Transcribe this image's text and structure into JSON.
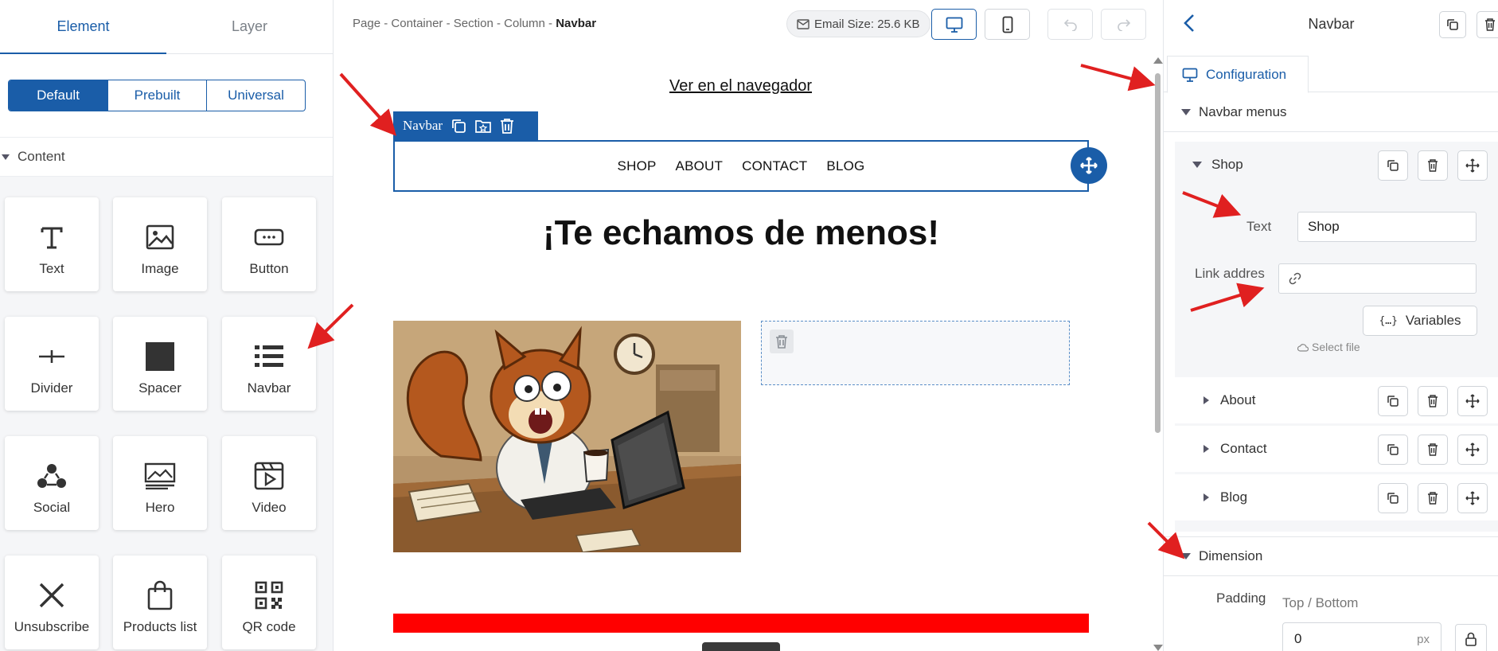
{
  "left_panel": {
    "tabs": [
      "Element",
      "Layer"
    ],
    "segments": [
      "Default",
      "Prebuilt",
      "Universal"
    ],
    "section_title": "Content",
    "tiles": [
      {
        "label": "Text",
        "icon": "text-icon"
      },
      {
        "label": "Image",
        "icon": "image-icon"
      },
      {
        "label": "Button",
        "icon": "button-icon"
      },
      {
        "label": "Divider",
        "icon": "divider-icon"
      },
      {
        "label": "Spacer",
        "icon": "spacer-icon"
      },
      {
        "label": "Navbar",
        "icon": "navbar-icon"
      },
      {
        "label": "Social",
        "icon": "social-icon"
      },
      {
        "label": "Hero",
        "icon": "hero-icon"
      },
      {
        "label": "Video",
        "icon": "video-icon"
      },
      {
        "label": "Unsubscribe",
        "icon": "unsubscribe-icon"
      },
      {
        "label": "Products list",
        "icon": "shopping-bag-icon"
      },
      {
        "label": "QR code",
        "icon": "qr-code-icon"
      }
    ]
  },
  "topbar": {
    "breadcrumb": [
      "Page",
      "Container",
      "Section",
      "Column"
    ],
    "breadcrumb_sep": " - ",
    "breadcrumb_current": "Navbar",
    "email_size": "Email Size: 25.6 KB"
  },
  "canvas": {
    "view_in_browser": "Ver en el navegador",
    "navbar_tag": "Navbar",
    "nav_links": [
      "SHOP",
      "ABOUT",
      "CONTACT",
      "BLOG"
    ],
    "headline": "¡Te echamos de menos!"
  },
  "right_panel": {
    "title": "Navbar",
    "tab": "Configuration",
    "navbar_menus": "Navbar menus",
    "menus": [
      "Shop",
      "About",
      "Contact",
      "Blog"
    ],
    "text_label": "Text",
    "text_value": "Shop",
    "link_label": "Link addres",
    "link_value": "",
    "variables_label": "Variables",
    "select_file": "Select file",
    "dimension": "Dimension",
    "padding_label": "Padding",
    "padding_sub": "Top / Bottom",
    "padding_value": "0",
    "padding_unit": "px"
  },
  "colors": {
    "accent": "#1a5da8",
    "red_block": "#ff0000",
    "annotation": "#e02020"
  }
}
